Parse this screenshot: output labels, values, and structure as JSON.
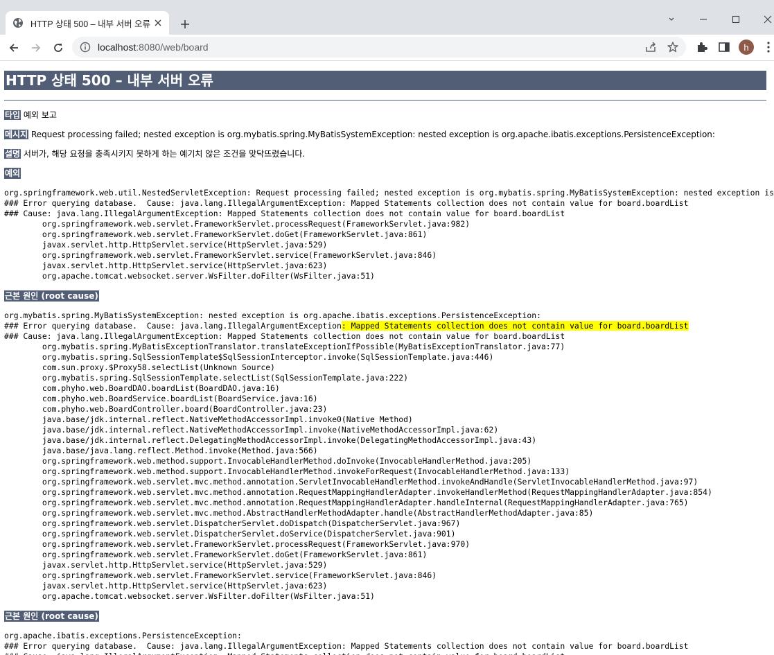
{
  "browser": {
    "tab_title": "HTTP 상태 500 – 내부 서버 오류",
    "url_host": "localhost",
    "url_rest": ":8080/web/board",
    "avatar_letter": "h",
    "icons": [
      "globe-icon",
      "close-icon",
      "plus-icon",
      "minimize-icon",
      "maximize-icon",
      "window-close-icon",
      "back-icon",
      "forward-icon",
      "reload-icon",
      "info-icon",
      "share-icon",
      "star-icon",
      "extensions-icon",
      "sidepanel-icon",
      "menu-icon"
    ]
  },
  "page": {
    "title": "HTTP 상태 500 – 내부 서버 오류",
    "type_label": "타입",
    "type_value": "예외 보고",
    "message_label": "메시지",
    "message_value": "Request processing failed; nested exception is org.mybatis.spring.MyBatisSystemException: nested exception is org.apache.ibatis.exceptions.PersistenceException:",
    "description_label": "설명",
    "description_value": "서버가, 해당 요청을 충족시키지 못하게 하는 예기치 않은 조건을 맞닥뜨렸습니다.",
    "exception_label": "예외",
    "exception_trace": "org.springframework.web.util.NestedServletException: Request processing failed; nested exception is org.mybatis.spring.MyBatisSystemException: nested exception is org.apache.ibatis.exceptions.PersistenceException:\n### Error querying database.  Cause: java.lang.IllegalArgumentException: Mapped Statements collection does not contain value for board.boardList\n### Cause: java.lang.IllegalArgumentException: Mapped Statements collection does not contain value for board.boardList\n\torg.springframework.web.servlet.FrameworkServlet.processRequest(FrameworkServlet.java:982)\n\torg.springframework.web.servlet.FrameworkServlet.doGet(FrameworkServlet.java:861)\n\tjavax.servlet.http.HttpServlet.service(HttpServlet.java:529)\n\torg.springframework.web.servlet.FrameworkServlet.service(FrameworkServlet.java:846)\n\tjavax.servlet.http.HttpServlet.service(HttpServlet.java:623)\n\torg.apache.tomcat.websocket.server.WsFilter.doFilter(WsFilter.java:51)",
    "root_cause_label_1": "근본 원인 (root cause)",
    "root1_line1": "org.mybatis.spring.MyBatisSystemException: nested exception is org.apache.ibatis.exceptions.PersistenceException:",
    "root1_line2_a": "### Error querying database.  Cause: java.lang.IllegalArgumentException",
    "root1_line2_b": ": Mapped Statements collection does not contain value for board.boardList",
    "root1_rest": "### Cause: java.lang.IllegalArgumentException: Mapped Statements collection does not contain value for board.boardList\n\torg.mybatis.spring.MyBatisExceptionTranslator.translateExceptionIfPossible(MyBatisExceptionTranslator.java:77)\n\torg.mybatis.spring.SqlSessionTemplate$SqlSessionInterceptor.invoke(SqlSessionTemplate.java:446)\n\tcom.sun.proxy.$Proxy58.selectList(Unknown Source)\n\torg.mybatis.spring.SqlSessionTemplate.selectList(SqlSessionTemplate.java:222)\n\tcom.phyho.web.BoardDAO.boardList(BoardDAO.java:16)\n\tcom.phyho.web.BoardService.boardList(BoardService.java:16)\n\tcom.phyho.web.BoardController.board(BoardController.java:23)\n\tjava.base/jdk.internal.reflect.NativeMethodAccessorImpl.invoke0(Native Method)\n\tjava.base/jdk.internal.reflect.NativeMethodAccessorImpl.invoke(NativeMethodAccessorImpl.java:62)\n\tjava.base/jdk.internal.reflect.DelegatingMethodAccessorImpl.invoke(DelegatingMethodAccessorImpl.java:43)\n\tjava.base/java.lang.reflect.Method.invoke(Method.java:566)\n\torg.springframework.web.method.support.InvocableHandlerMethod.doInvoke(InvocableHandlerMethod.java:205)\n\torg.springframework.web.method.support.InvocableHandlerMethod.invokeForRequest(InvocableHandlerMethod.java:133)\n\torg.springframework.web.servlet.mvc.method.annotation.ServletInvocableHandlerMethod.invokeAndHandle(ServletInvocableHandlerMethod.java:97)\n\torg.springframework.web.servlet.mvc.method.annotation.RequestMappingHandlerAdapter.invokeHandlerMethod(RequestMappingHandlerAdapter.java:854)\n\torg.springframework.web.servlet.mvc.method.annotation.RequestMappingHandlerAdapter.handleInternal(RequestMappingHandlerAdapter.java:765)\n\torg.springframework.web.servlet.mvc.method.AbstractHandlerMethodAdapter.handle(AbstractHandlerMethodAdapter.java:85)\n\torg.springframework.web.servlet.DispatcherServlet.doDispatch(DispatcherServlet.java:967)\n\torg.springframework.web.servlet.DispatcherServlet.doService(DispatcherServlet.java:901)\n\torg.springframework.web.servlet.FrameworkServlet.processRequest(FrameworkServlet.java:970)\n\torg.springframework.web.servlet.FrameworkServlet.doGet(FrameworkServlet.java:861)\n\tjavax.servlet.http.HttpServlet.service(HttpServlet.java:529)\n\torg.springframework.web.servlet.FrameworkServlet.service(FrameworkServlet.java:846)\n\tjavax.servlet.http.HttpServlet.service(HttpServlet.java:623)\n\torg.apache.tomcat.websocket.server.WsFilter.doFilter(WsFilter.java:51)",
    "root_cause_label_2": "근본 원인 (root cause)",
    "root2_trace": "org.apache.ibatis.exceptions.PersistenceException:\n### Error querying database.  Cause: java.lang.IllegalArgumentException: Mapped Statements collection does not contain value for board.boardList\n### Cause: java.lang.IllegalArgumentException: Mapped Statements collection does not contain value for board.boardList"
  },
  "colors": {
    "header_bg": "#525d76",
    "highlight": "#ffff00"
  }
}
